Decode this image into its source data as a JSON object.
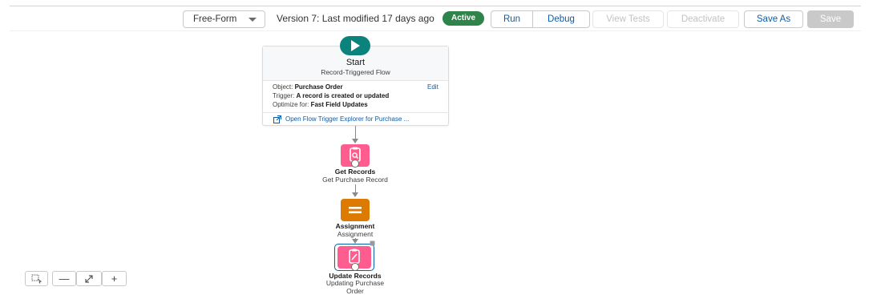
{
  "toolbar": {
    "mode": "Free-Form",
    "version_text": "Version 7: Last modified 17 days ago",
    "status_badge": "Active",
    "run": "Run",
    "debug": "Debug",
    "view_tests": "View Tests",
    "deactivate": "Deactivate",
    "save_as": "Save As",
    "save": "Save"
  },
  "start": {
    "title": "Start",
    "subtitle": "Record-Triggered Flow",
    "object_label": "Object:",
    "object_value": "Purchase Order",
    "trigger_label": "Trigger:",
    "trigger_value": "A record is created or updated",
    "optimize_label": "Optimize for:",
    "optimize_value": "Fast Field Updates",
    "edit": "Edit",
    "explorer_link": "Open Flow Trigger Explorer for Purchase ..."
  },
  "nodes": [
    {
      "title": "Get Records",
      "subtitle": "Get Purchase Record",
      "icon": "get-records-icon",
      "color": "#ff5d8f"
    },
    {
      "title": "Assignment",
      "subtitle": "Assignment",
      "icon": "assignment-icon",
      "color": "#dd7a01"
    },
    {
      "title": "Update Records",
      "subtitle": "Updating Purchase Order",
      "icon": "update-records-icon",
      "color": "#ff5d8f"
    }
  ],
  "colors": {
    "accent": "#0b5cab",
    "start": "#0b827c",
    "active": "#2e844a"
  }
}
